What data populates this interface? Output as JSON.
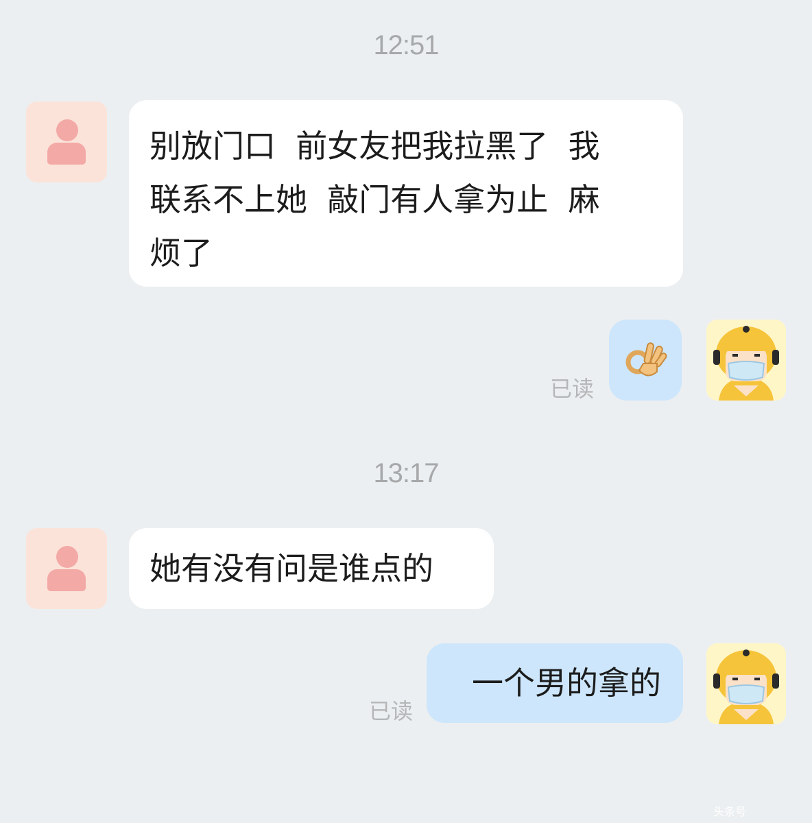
{
  "chat": {
    "timestamps": [
      "12:51",
      "13:17"
    ],
    "messages": [
      {
        "from": "other",
        "text": "别放门口  前女友把我拉黑了  我\n联系不上她  敲门有人拿为止  麻\n烦了"
      },
      {
        "from": "me",
        "type": "emoji",
        "emoji_name": "ok-hand-icon",
        "status": "已读"
      },
      {
        "from": "other",
        "text": "她有没有问是谁点的"
      },
      {
        "from": "me",
        "text": "一个男的拿的",
        "status": "已读"
      }
    ]
  },
  "colors": {
    "background": "#eceff1",
    "incoming_bubble": "#ffffff",
    "outgoing_bubble": "#cde6fb",
    "other_avatar_bg": "#fbe3d9",
    "other_avatar_icon": "#f3a9a6",
    "my_avatar_helmet": "#f6c43a",
    "mask": "#cfe8f6"
  },
  "watermark": "头条号"
}
